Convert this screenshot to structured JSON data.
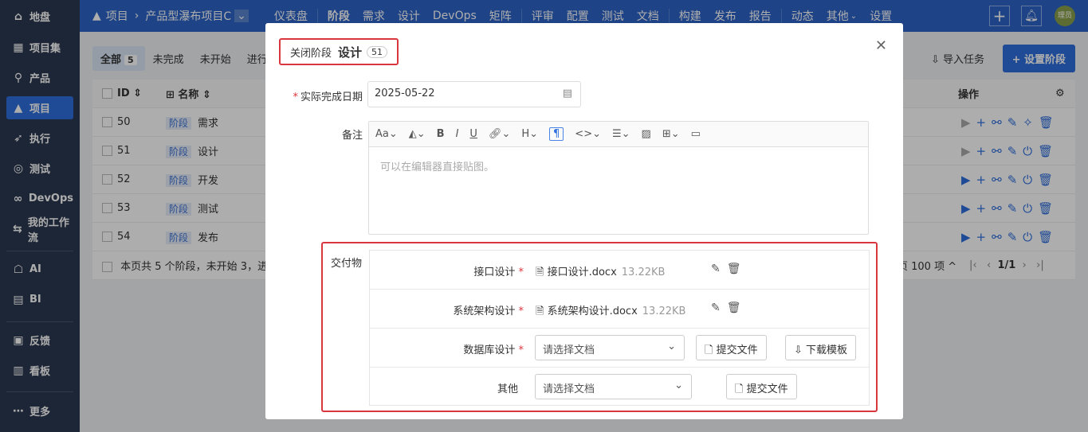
{
  "sidebar": {
    "items": [
      {
        "label": "地盘",
        "icon": "home-icon"
      },
      {
        "label": "项目集",
        "icon": "grid-icon"
      },
      {
        "label": "产品",
        "icon": "bulb-icon"
      },
      {
        "label": "项目",
        "icon": "rocket-icon",
        "active": true
      },
      {
        "label": "执行",
        "icon": "run-icon"
      },
      {
        "label": "测试",
        "icon": "test-icon"
      },
      {
        "label": "DevOps",
        "icon": "infinity-icon"
      },
      {
        "label": "我的工作流",
        "icon": "flow-icon"
      },
      {
        "label": "AI",
        "icon": "robot-icon"
      },
      {
        "label": "BI",
        "icon": "chart-icon"
      },
      {
        "label": "反馈",
        "icon": "feedback-icon"
      },
      {
        "label": "看板",
        "icon": "kanban-icon"
      },
      {
        "label": "更多",
        "icon": "more-icon"
      }
    ]
  },
  "topbar": {
    "breadcrumb": [
      "项目",
      "产品型瀑布项目C"
    ],
    "nav": [
      "仪表盘",
      "阶段",
      "需求",
      "设计",
      "DevOps",
      "矩阵",
      "评审",
      "配置",
      "测试",
      "文档",
      "构建",
      "发布",
      "报告",
      "动态",
      "其他",
      "设置"
    ],
    "avatar": "理员"
  },
  "main": {
    "tabs": [
      {
        "label": "全部",
        "count": "5"
      },
      {
        "label": "未完成"
      },
      {
        "label": "未开始"
      },
      {
        "label": "进行"
      }
    ],
    "import_label": "导入任务",
    "set_stage_label": "设置阶段",
    "table": {
      "headers": {
        "id": "ID",
        "name": "名称",
        "ops": "操作"
      },
      "rows": [
        {
          "id": "50",
          "tag": "阶段",
          "name": "需求"
        },
        {
          "id": "51",
          "tag": "阶段",
          "name": "设计"
        },
        {
          "id": "52",
          "tag": "阶段",
          "name": "开发"
        },
        {
          "id": "53",
          "tag": "阶段",
          "name": "测试"
        },
        {
          "id": "54",
          "tag": "阶段",
          "name": "发布"
        }
      ],
      "footer": "本页共 5 个阶段，未开始 3，进",
      "page_size": "页 100 项",
      "pager": "1/1"
    }
  },
  "modal": {
    "title": "关闭阶段",
    "stage": "设计",
    "stage_id": "51",
    "date_label": "实际完成日期",
    "date_value": "2025-05-22",
    "note_label": "备注",
    "note_placeholder": "可以在编辑器直接贴图。",
    "deliverables_label": "交付物",
    "deliverables": [
      {
        "label": "接口设计",
        "required": true,
        "file": "接口设计.docx",
        "size": "13.22KB"
      },
      {
        "label": "系统架构设计",
        "required": true,
        "file": "系统架构设计.docx",
        "size": "13.22KB"
      },
      {
        "label": "数据库设计",
        "required": true,
        "select_placeholder": "请选择文档",
        "submit": "提交文件",
        "download": "下载模板"
      },
      {
        "label": "其他",
        "required": false,
        "select_placeholder": "请选择文档",
        "submit": "提交文件"
      }
    ]
  }
}
